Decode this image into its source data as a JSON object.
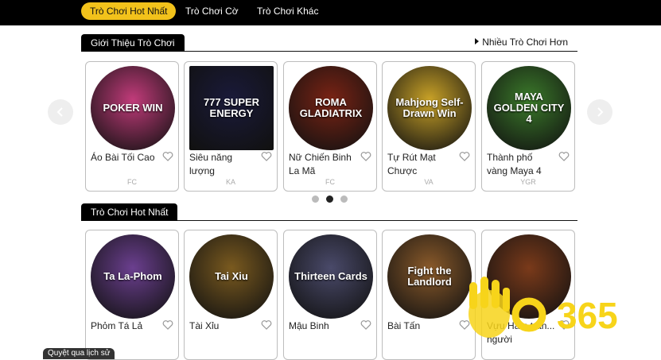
{
  "nav": {
    "tabs": [
      {
        "label": "Trò Chơi Hot Nhất",
        "active": true
      },
      {
        "label": "Trò Chơi Cờ",
        "active": false
      },
      {
        "label": "Trò Chơi Khác",
        "active": false
      }
    ]
  },
  "intro": {
    "title": "Giới Thiệu Trò Chơi",
    "more_link": "Nhiều Trò Chơi Hơn",
    "cards": [
      {
        "name": "Áo Bài Tối Cao",
        "provider": "FC",
        "art": "POKER WIN",
        "color": "#c13b7a"
      },
      {
        "name": "Siêu năng lượng",
        "provider": "KA",
        "art": "777 SUPER ENERGY",
        "color": "#1a1a3a"
      },
      {
        "name": "Nữ Chiến Binh La Mã",
        "provider": "FC",
        "art": "ROMA GLADIATRIX",
        "color": "#7a2314"
      },
      {
        "name": "Tự Rút Mạt Chược",
        "provider": "VA",
        "art": "Mahjong Self-Drawn Win",
        "color": "#c9a227"
      },
      {
        "name": "Thành phố vàng Maya 4",
        "provider": "YGR",
        "art": "MAYA GOLDEN CITY 4",
        "color": "#3b7a2a"
      }
    ],
    "pager": {
      "total": 3,
      "current": 2
    }
  },
  "hot": {
    "title": "Trò Chơi Hot Nhất",
    "cards": [
      {
        "name": "Phỏm Tá Lả",
        "art": "Ta La-Phom",
        "color": "#6b3f8f"
      },
      {
        "name": "Tài Xỉu",
        "art": "Tai Xiu",
        "color": "#7a5a1f"
      },
      {
        "name": "Mậu Binh",
        "art": "Thirteen Cards",
        "color": "#4a4a6a"
      },
      {
        "name": "Bài Tấn",
        "art": "Fight the Landlord",
        "color": "#8a5a2a"
      },
      {
        "name": "Vựu Hàm trắn... người",
        "art": "",
        "color": "#7a3a1a"
      }
    ]
  },
  "footer": {
    "history_label": "Quyệt qua lịch sử",
    "brand": "OK365"
  },
  "colors": {
    "accent": "#f2c21b",
    "heart": "#999999"
  }
}
